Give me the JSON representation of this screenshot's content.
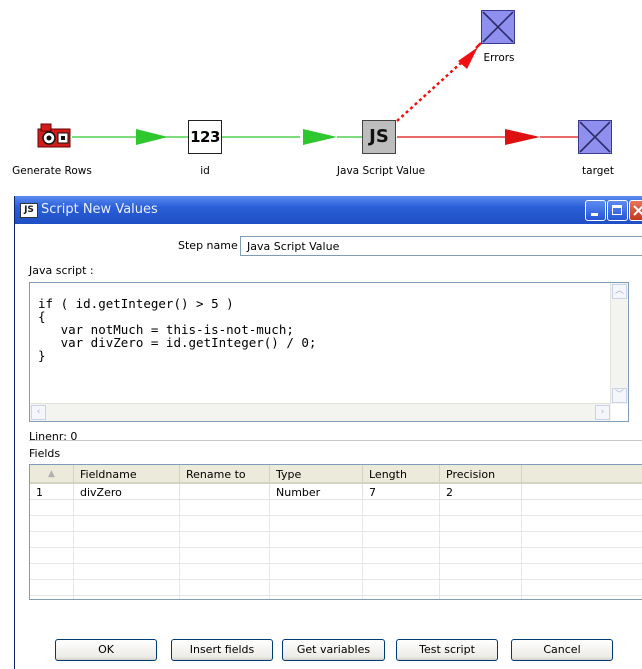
{
  "canvas": {
    "steps": [
      {
        "label": "Generate Rows",
        "icon": "generate-rows-icon"
      },
      {
        "label": "id",
        "icon_text": "123"
      },
      {
        "label": "Java Script Value",
        "icon_text": "JS"
      },
      {
        "label": "target",
        "icon": "dummy-step-icon"
      },
      {
        "label": "Errors",
        "icon": "dummy-step-icon"
      }
    ],
    "hop_colors": {
      "normal": "#2ec82e",
      "error": "#dd1111",
      "error_hop": "#ee1111"
    }
  },
  "dialog": {
    "app_icon": "JS",
    "title": "Script New Values",
    "step_name_label": "Step name",
    "step_name_value": "Java Script Value",
    "java_script_label": "Java script :",
    "code": "if ( id.getInteger() > 5 )\n{\n   var notMuch = this-is-not-much;\n   var divZero = id.getInteger() / 0;\n}",
    "linenr_label": "Linenr: 0",
    "fields_label": "Fields",
    "table": {
      "sort_glyph": "▲",
      "columns": [
        "Fieldname",
        "Rename to",
        "Type",
        "Length",
        "Precision"
      ],
      "rows": [
        [
          "1",
          "divZero",
          "",
          "Number",
          "7",
          "2"
        ]
      ]
    },
    "buttons": {
      "ok": "OK",
      "insert_fields": "Insert fields",
      "get_variables": "Get variables",
      "test_script": "Test script",
      "cancel": "Cancel"
    }
  }
}
